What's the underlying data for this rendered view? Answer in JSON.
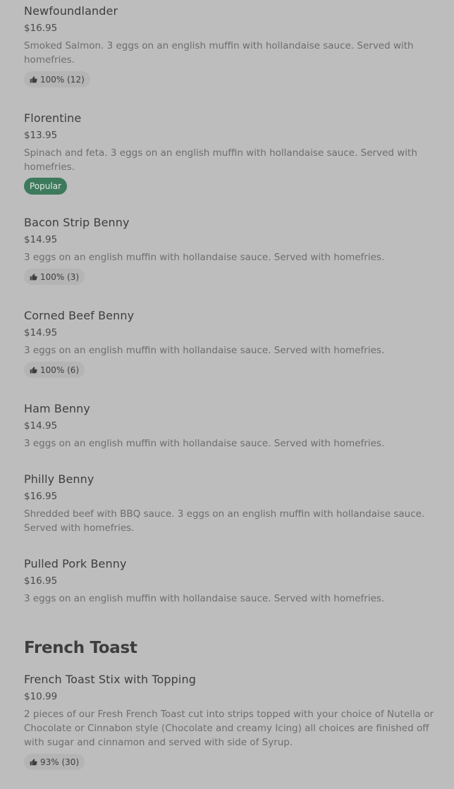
{
  "items": [
    {
      "name": "Newfoundlander",
      "price": "$16.95",
      "description": "Smoked Salmon. 3 eggs on an english muffin with hollandaise sauce. Served with homefries.",
      "rating": "100% (12)"
    },
    {
      "name": "Florentine",
      "price": "$13.95",
      "description": "Spinach and feta. 3 eggs on an english muffin with hollandaise sauce. Served with homefries.",
      "badge": "Popular"
    },
    {
      "name": "Bacon Strip Benny",
      "price": "$14.95",
      "description": "3 eggs on an english muffin with hollandaise sauce. Served with homefries.",
      "rating": "100% (3)"
    },
    {
      "name": "Corned Beef Benny",
      "price": "$14.95",
      "description": "3 eggs on an english muffin with hollandaise sauce. Served with homefries.",
      "rating": "100% (6)"
    },
    {
      "name": "Ham Benny",
      "price": "$14.95",
      "description": "3 eggs on an english muffin with hollandaise sauce. Served with homefries."
    },
    {
      "name": "Philly Benny",
      "price": "$16.95",
      "description": "Shredded beef with BBQ sauce. 3 eggs on an english muffin with hollandaise sauce. Served with homefries."
    },
    {
      "name": "Pulled Pork Benny",
      "price": "$16.95",
      "description": "3 eggs on an english muffin with hollandaise sauce. Served with homefries."
    }
  ],
  "french_toast": {
    "section_title": "French Toast",
    "items": [
      {
        "name": "French Toast Stix with Topping",
        "price": "$10.99",
        "description": "2 pieces of our Fresh French Toast cut into strips topped with your choice of Nutella or Chocolate or Cinnabon style (Chocolate and creamy Icing) all choices are finished off with sugar and cinnamon and served with side of Syrup.",
        "rating": "93% (30)"
      }
    ]
  },
  "icons": {
    "rating": "thumbs-up-icon"
  },
  "colors": {
    "background": "#bdbdbd",
    "popular_badge": "#3d7a5c",
    "rating_chip": "#b4b4b4"
  }
}
